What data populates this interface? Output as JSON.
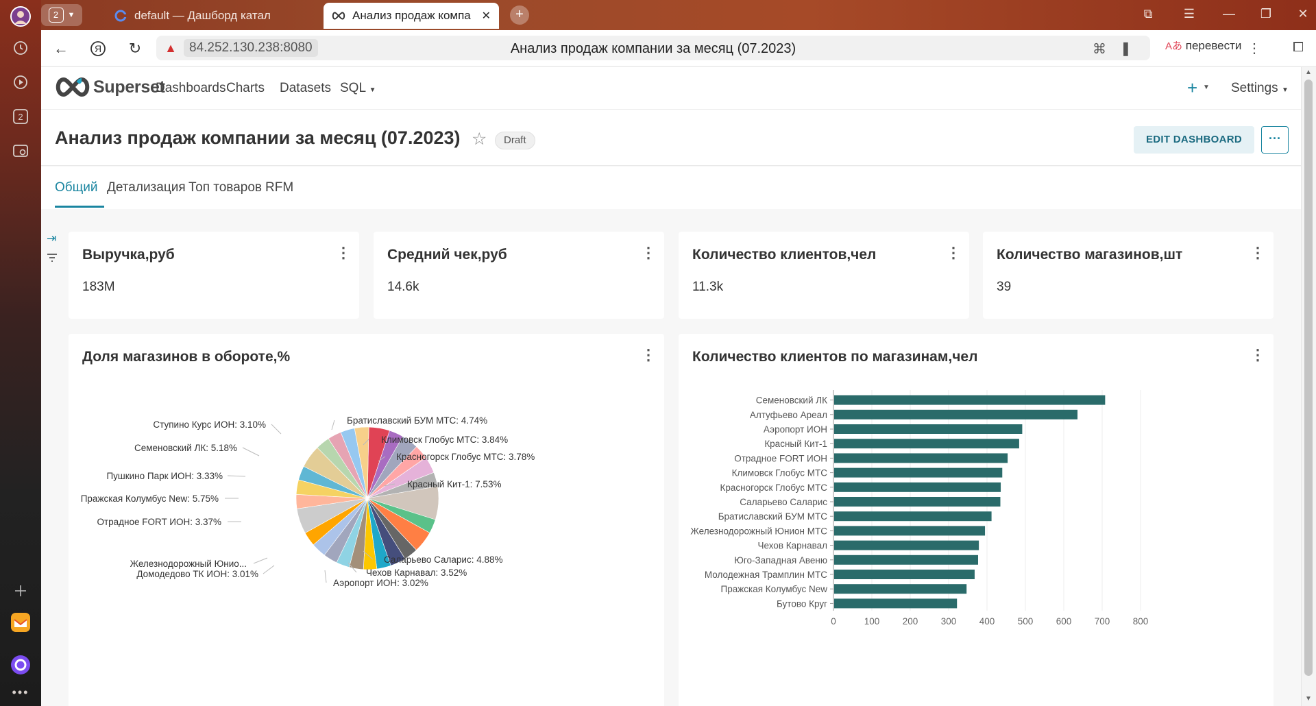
{
  "browser": {
    "tab_count_badge": "2",
    "tabs": [
      {
        "title": "default — Дашборд катал"
      },
      {
        "title": "Анализ продаж компа"
      }
    ],
    "url_host": "84.252.130.238:8080",
    "page_title": "Анализ продаж компании за месяц (07.2023)",
    "translate_label": "перевести",
    "rail_badge": "2"
  },
  "app": {
    "brand": "Superset",
    "menu": [
      "Dashboards",
      "Charts",
      "Datasets",
      "SQL"
    ],
    "settings_label": "Settings"
  },
  "dashboard": {
    "title": "Анализ продаж компании за месяц (07.2023)",
    "status_badge": "Draft",
    "edit_button": "EDIT DASHBOARD",
    "more_button": "···",
    "tabs": [
      "Общий",
      "Детализация",
      "Топ товаров",
      "RFM"
    ],
    "active_tab": "Общий"
  },
  "kpis": [
    {
      "title": "Выручка,руб",
      "value": "183M"
    },
    {
      "title": "Средний чек,руб",
      "value": "14.6k"
    },
    {
      "title": "Количество клиентов,чел",
      "value": "11.3k"
    },
    {
      "title": "Количество магазинов,шт",
      "value": "39"
    }
  ],
  "pie_card": {
    "title": "Доля магазинов в обороте,%"
  },
  "bar_card": {
    "title": "Количество клиентов по магазинам,чел"
  },
  "chart_data": [
    {
      "type": "pie",
      "title": "Доля магазинов в обороте,%",
      "labeled_slices": [
        {
          "name": "Братиславский БУМ МТС",
          "value": 4.74,
          "label": "Братиславский БУМ МТС: 4.74%"
        },
        {
          "name": "Климовск Глобус МТС",
          "value": 3.84,
          "label": "Климовск Глобус МТС: 3.84%"
        },
        {
          "name": "Красногорск Глобус МТС",
          "value": 3.78,
          "label": "Красногорск Глобус МТС: 3.78%"
        },
        {
          "name": "Красный Кит-1",
          "value": 7.53,
          "label": "Красный Кит-1: 7.53%"
        },
        {
          "name": "Саларьево Саларис",
          "value": 4.88,
          "label": "Саларьево Саларис: 4.88%"
        },
        {
          "name": "Чехов Карнавал",
          "value": 3.52,
          "label": "Чехов Карнавал: 3.52%"
        },
        {
          "name": "Аэропорт ИОН",
          "value": 3.02,
          "label": "Аэропорт ИОН: 3.02%"
        },
        {
          "name": "Домодедово ТК ИОН",
          "value": 3.01,
          "label": "Домодедово ТК ИОН: 3.01%"
        },
        {
          "name": "Железнодорожный Юнио...",
          "value": null,
          "label": "Железнодорожный Юнио..."
        },
        {
          "name": "Отрадное FORT ИОН",
          "value": 3.37,
          "label": "Отрадное FORT ИОН: 3.37%"
        },
        {
          "name": "Пражская Колумбус New",
          "value": 5.75,
          "label": "Пражская Колумбус New: 5.75%"
        },
        {
          "name": "Пушкино Парк ИОН",
          "value": 3.33,
          "label": "Пушкино Парк ИОН: 3.33%"
        },
        {
          "name": "Семеновский ЛК",
          "value": 5.18,
          "label": "Семеновский ЛК: 5.18%"
        },
        {
          "name": "Ступино Курс ИОН",
          "value": 3.1,
          "label": "Ступино Курс ИОН: 3.10%"
        }
      ],
      "colors": [
        "#e04355",
        "#a86cc1",
        "#a1a6bd",
        "#ffa6a6",
        "#e5b2d9",
        "#b2b2b2",
        "#d1c6bc",
        "#5ac189",
        "#ff7f44",
        "#666666",
        "#454e7c",
        "#1fa8c9",
        "#fcc700",
        "#a38f79",
        "#8fd3e4",
        "#a1a6bd",
        "#acc3e9",
        "#ffa500",
        "#ccc",
        "#ffb69b",
        "#f5d262",
        "#5fb7d4",
        "#e3cd96",
        "#b7d6ae",
        "#e6a4b3",
        "#96c8f0",
        "#f7d08a",
        "#ffb6a6"
      ]
    },
    {
      "type": "bar",
      "orientation": "horizontal",
      "title": "Количество клиентов по магазинам,чел",
      "categories": [
        "Семеновский ЛК",
        "Алтуфьево Ареал",
        "Аэропорт ИОН",
        "Красный Кит-1",
        "Отрадное FORT ИОН",
        "Климовск Глобус МТС",
        "Красногорск Глобус МТС",
        "Саларьево Саларис",
        "Братиславский БУМ МТС",
        "Железнодорожный Юнион МТС",
        "Чехов Карнавал",
        "Юго-Западная Авеню",
        "Молодежная Трамплин МТС",
        "Пражская Колумбус New",
        "Бутово Круг"
      ],
      "values": [
        706,
        634,
        490,
        482,
        452,
        438,
        434,
        433,
        410,
        393,
        377,
        375,
        366,
        345,
        320
      ],
      "xlim": [
        0,
        800
      ],
      "xticks": [
        0,
        100,
        200,
        300,
        400,
        500,
        600,
        700,
        800
      ],
      "color": "#2a6b6a",
      "grid": true
    }
  ]
}
